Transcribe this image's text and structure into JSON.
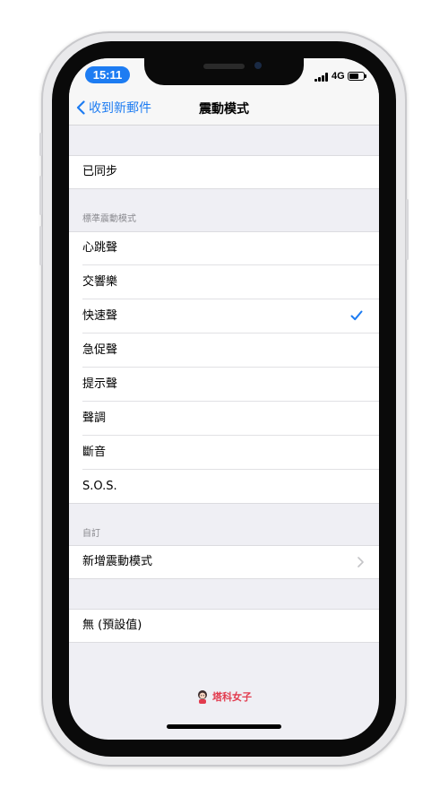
{
  "status_bar": {
    "time": "15:11",
    "network": "4G",
    "battery_level": 0.65,
    "signal_icon": "cellular-signal-icon",
    "battery_icon": "battery-icon"
  },
  "nav": {
    "back_label": "收到新郵件",
    "title": "震動模式",
    "back_icon": "chevron-left-icon"
  },
  "synced": {
    "label": "已同步"
  },
  "standard": {
    "header": "標準震動模式",
    "items": [
      {
        "label": "心跳聲",
        "selected": false
      },
      {
        "label": "交響樂",
        "selected": false
      },
      {
        "label": "快速聲",
        "selected": true
      },
      {
        "label": "急促聲",
        "selected": false
      },
      {
        "label": "提示聲",
        "selected": false
      },
      {
        "label": "聲調",
        "selected": false
      },
      {
        "label": "斷音",
        "selected": false
      },
      {
        "label": "S.O.S.",
        "selected": false
      }
    ]
  },
  "custom": {
    "header": "自訂",
    "add_label": "新增震動模式",
    "chevron_icon": "chevron-right-icon"
  },
  "none_option": {
    "label": "無 (預設值)"
  },
  "watermark": {
    "text": "塔科女子"
  },
  "colors": {
    "accent": "#1d7cf2",
    "background": "#efeff4",
    "watermark": "#e23b4e"
  }
}
